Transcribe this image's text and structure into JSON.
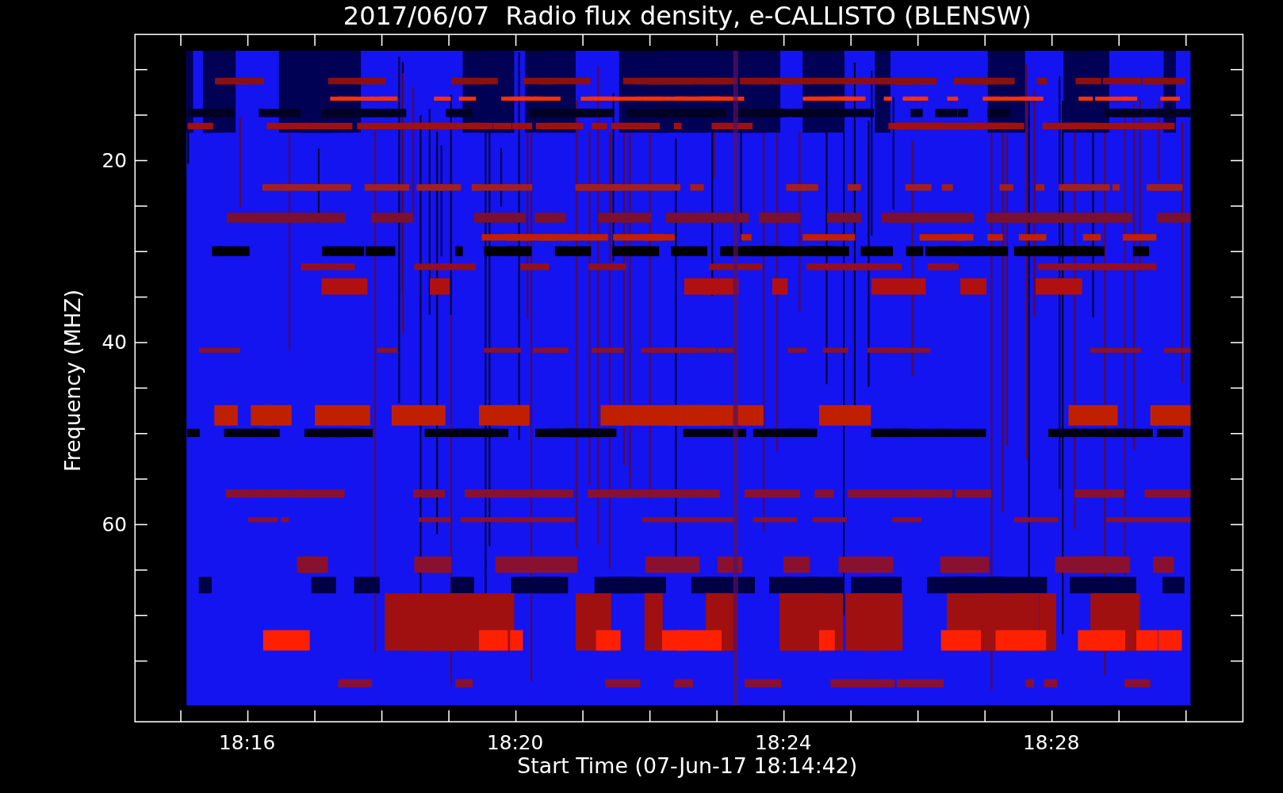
{
  "title": "2017/06/07  Radio flux density, e-CALLISTO (BLENSW)",
  "y_axis": {
    "label": "Frequency (MHZ)",
    "ticks": [
      "20",
      "40",
      "60"
    ]
  },
  "x_axis": {
    "label": "Start Time (07-Jun-17 18:14:42)",
    "ticks": [
      "18:16",
      "18:20",
      "18:24",
      "18:28"
    ]
  }
}
